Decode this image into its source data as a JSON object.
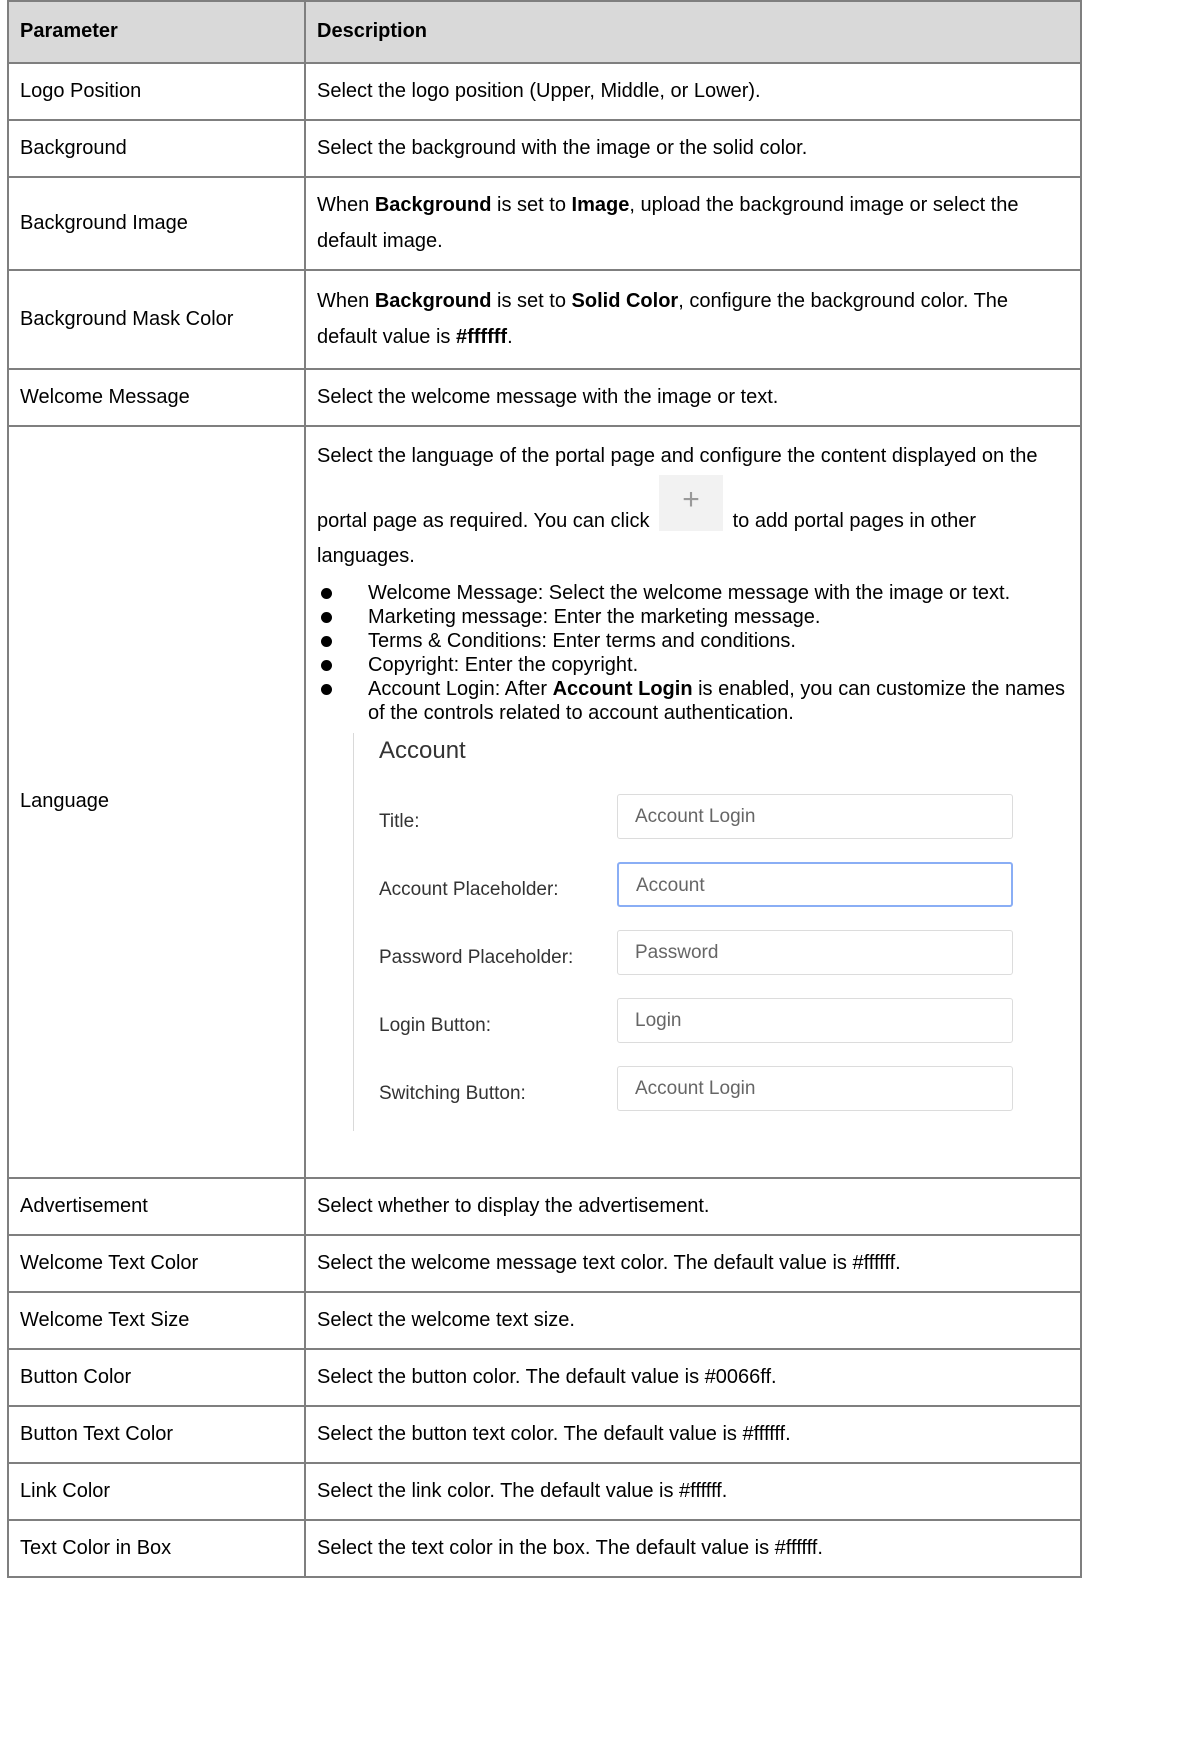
{
  "headers": {
    "parameter": "Parameter",
    "description": "Description"
  },
  "rows": [
    {
      "param": "Logo Position",
      "desc": "Select the logo position (Upper, Middle, or Lower)."
    },
    {
      "param": "Background",
      "desc": "Select the background with the image or the solid color."
    },
    {
      "param": "Background Image",
      "desc_a": "When ",
      "desc_b": "Background",
      "desc_c": " is set to ",
      "desc_d": "Image",
      "desc_e": ", upload the background image or select the default image."
    },
    {
      "param": "Background Mask Color",
      "desc_a": "When ",
      "desc_b": "Background",
      "desc_c": " is set to ",
      "desc_d": "Solid Color",
      "desc_e": ", configure the background color. The default value is ",
      "desc_f": "#ffffff",
      "desc_g": "."
    },
    {
      "param": "Welcome Message",
      "desc": "Select the welcome message with the image or text."
    },
    {
      "param": "Language",
      "desc_a": "Select the language of the portal page and configure the content displayed on the portal page as required. You can click",
      "plus_glyph": "+",
      "desc_b": "to add portal pages in other languages.",
      "bullets": [
        "Welcome Message: Select the welcome message with the image or text.",
        "Marketing message: Enter the marketing message.",
        "Terms & Conditions: Enter terms and conditions.",
        "Copyright: Enter the copyright."
      ],
      "bullet5_a": "Account Login: After ",
      "bullet5_b": "Account Login",
      "bullet5_c": " is enabled, you can customize the names of the controls related to account authentication.",
      "account": {
        "heading": "Account",
        "fields": [
          {
            "label": "Title:",
            "value": "Account Login"
          },
          {
            "label": "Account Placeholder:",
            "value": "Account"
          },
          {
            "label": "Password Placeholder:",
            "value": "Password"
          },
          {
            "label": "Login Button:",
            "value": "Login"
          },
          {
            "label": "Switching Button:",
            "value": "Account Login"
          }
        ]
      }
    },
    {
      "param": "Advertisement",
      "desc": "Select whether to display the advertisement."
    },
    {
      "param": "Welcome Text Color",
      "desc": "Select the welcome message text color. The default value is #ffffff."
    },
    {
      "param": "Welcome Text Size",
      "desc": "Select the welcome text size."
    },
    {
      "param": "Button Color",
      "desc": "Select the button color. The default value is #0066ff."
    },
    {
      "param": "Button Text Color",
      "desc": "Select the button text color. The default value is #ffffff."
    },
    {
      "param": "Link Color",
      "desc": "Select the link color. The default value is #ffffff."
    },
    {
      "param": "Text Color in Box",
      "desc": "Select the text color in the box. The default value is #ffffff."
    }
  ],
  "colors": {
    "header_bg": "#d9d9d9",
    "border": "#7f7f7f",
    "focus_border": "#8aaef5"
  }
}
